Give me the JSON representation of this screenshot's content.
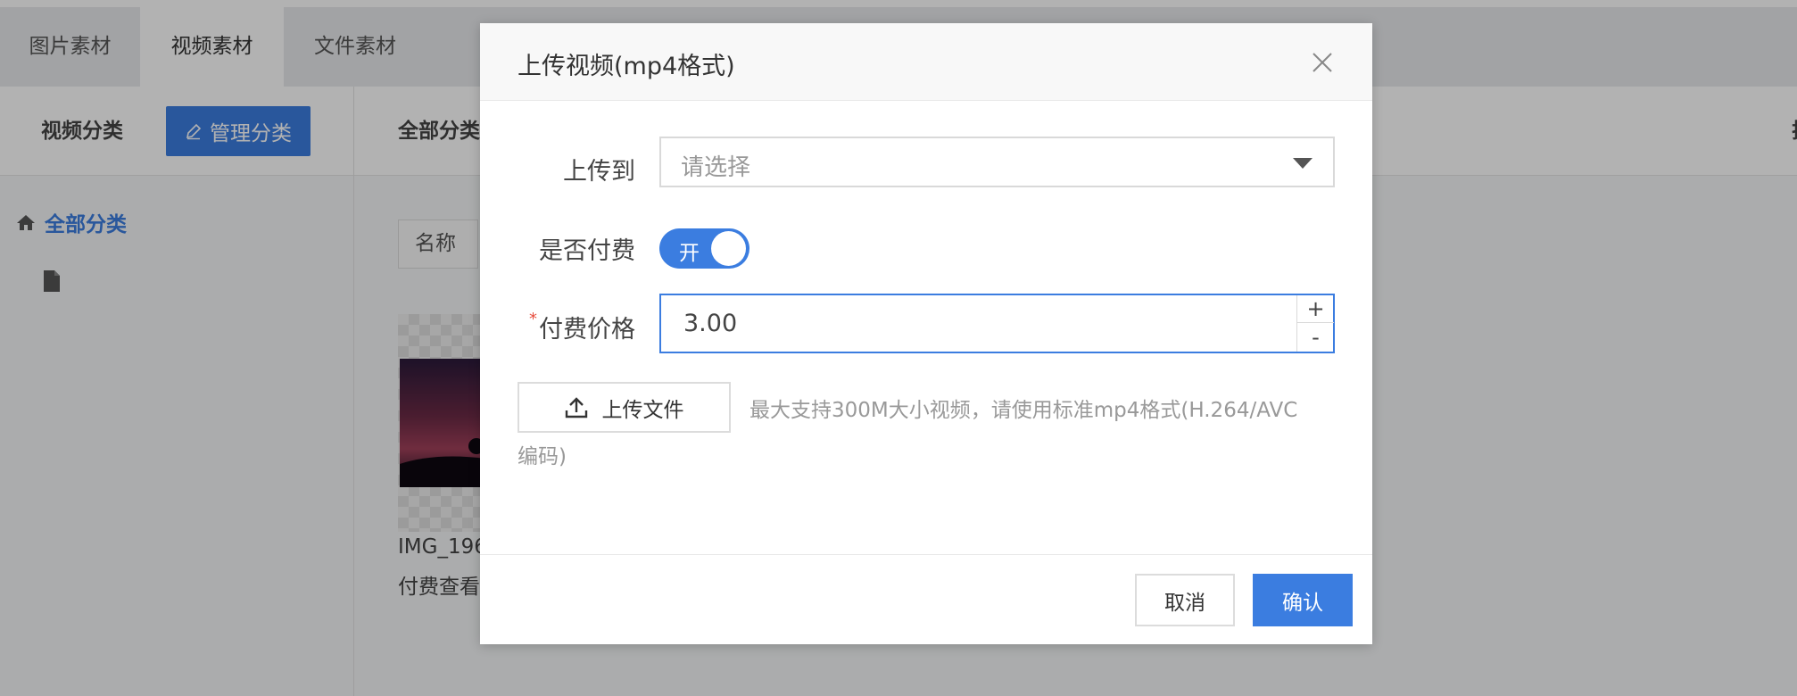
{
  "tabs": [
    {
      "label": "图片素材",
      "active": false
    },
    {
      "label": "视频素材",
      "active": true
    },
    {
      "label": "文件素材",
      "active": false
    }
  ],
  "toolbar": {
    "category_title": "视频分类",
    "manage_label": "管理分类",
    "crumb": "全部分类"
  },
  "sidebar": {
    "root_label": "全部分类"
  },
  "list": {
    "column_name": "名称",
    "item_name": "IMG_196",
    "item_sub": "付费查看"
  },
  "modal": {
    "title": "上传视频(mp4格式)",
    "upload_to_label": "上传到",
    "upload_to_placeholder": "请选择",
    "paid_label": "是否付费",
    "paid_toggle_text": "开",
    "paid_on": true,
    "price_label": "付费价格",
    "price_value": "3.00",
    "step_up": "+",
    "step_down": "-",
    "upload_button": "上传文件",
    "hint_line1": "最大支持300M大小视频，请使用标准mp4格式(H.264/AVC",
    "hint_line2": "编码)",
    "cancel": "取消",
    "confirm": "确认"
  },
  "colors": {
    "accent": "#3b7de0",
    "required": "#e74c3c"
  }
}
